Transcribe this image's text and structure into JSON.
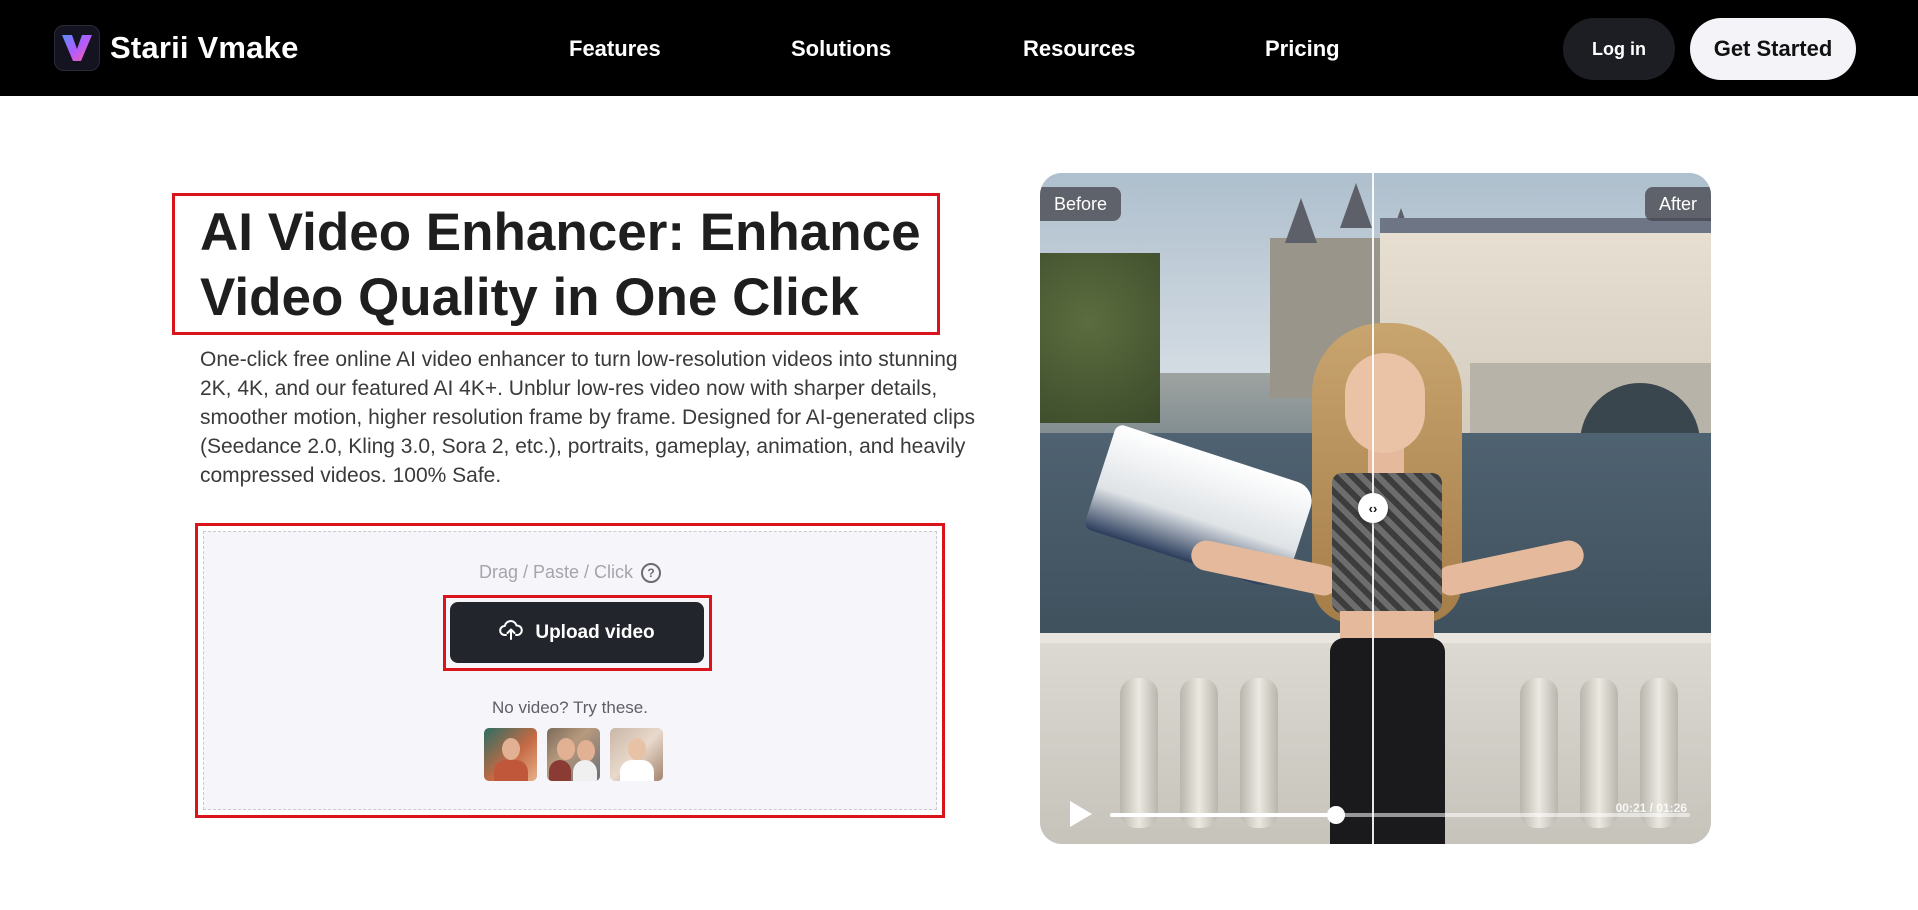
{
  "nav": {
    "brand": "Starii Vmake",
    "links": [
      "Features",
      "Solutions",
      "Resources",
      "Pricing"
    ],
    "login": "Log in",
    "get_started": "Get Started"
  },
  "hero": {
    "title_line1": "AI Video Enhancer: Enhance",
    "title_line2": "Video Quality in One Click",
    "description": "One-click free online AI video enhancer to turn low-resolution videos into stunning 2K, 4K, and our featured AI 4K+. Unblur low-res video now with sharper details, smoother motion, higher resolution frame by frame. Designed for AI-generated clips (Seedance 2.0, Kling 3.0, Sora 2, etc.), portraits, gameplay, animation, and heavily compressed videos. 100% Safe."
  },
  "upload": {
    "hint": "Drag / Paste / Click",
    "help_icon": "?",
    "button": "Upload video",
    "try_text": "No video? Try these.",
    "samples": [
      "sample-video-1",
      "sample-video-2",
      "sample-video-3"
    ]
  },
  "compare": {
    "before_label": "Before",
    "after_label": "After",
    "handle_glyph": "‹›",
    "time": "00:21 / 01:26",
    "progress": 0.39
  },
  "colors": {
    "nav_bg": "#000000",
    "highlight": "#d9151b",
    "button_dark": "#22252c",
    "panel_bg": "#f6f6fa"
  }
}
